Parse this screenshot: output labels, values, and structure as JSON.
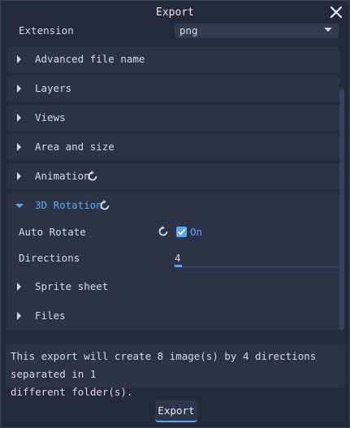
{
  "window": {
    "title": "Export"
  },
  "extension": {
    "label": "Extension",
    "value": "png"
  },
  "sections": [
    {
      "label": "Advanced file name",
      "reset": false
    },
    {
      "label": "Layers",
      "reset": false
    },
    {
      "label": "Views",
      "reset": false
    },
    {
      "label": "Area and size",
      "reset": false
    },
    {
      "label": "Animation",
      "reset": true
    },
    {
      "label": "3D Rotation",
      "reset": true,
      "open": true
    },
    {
      "label": "Sprite sheet",
      "reset": false
    },
    {
      "label": "Files",
      "reset": false
    }
  ],
  "rotation": {
    "auto_rotate_label": "Auto Rotate",
    "auto_rotate_checked": true,
    "auto_rotate_state": "On",
    "directions_label": "Directions",
    "directions_value": "4"
  },
  "info_text_line1": "This export will create 8 image(s) by 4 directions separated in 1",
  "info_text_line2": "different folder(s).",
  "export_button": "Export",
  "colors": {
    "accent": "#5aa9f0",
    "panel": "#2d3347",
    "background": "#252a3b"
  },
  "icons": {
    "close": "close-icon",
    "reset": "reset-icon",
    "expand": "chevron-right-icon",
    "collapse": "chevron-down-icon",
    "dropdown": "chevron-down-icon",
    "check": "check-icon"
  }
}
